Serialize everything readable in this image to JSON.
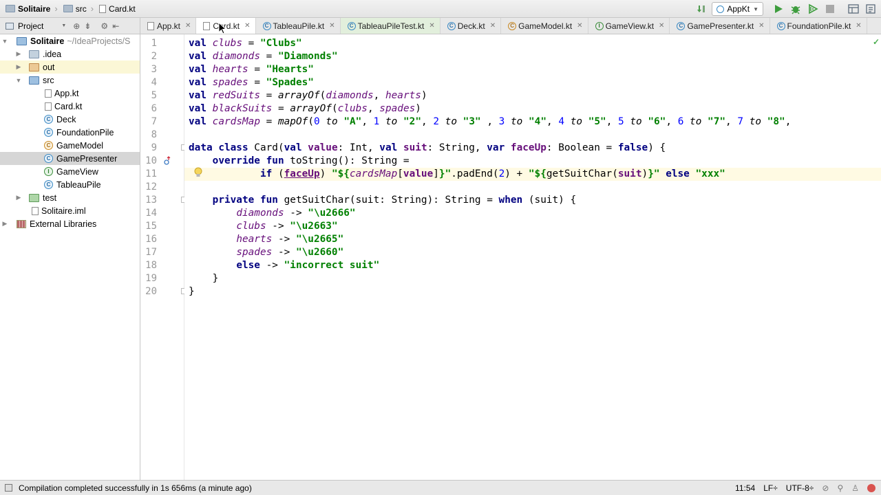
{
  "navbar": {
    "breadcrumbs": [
      "Solitaire",
      "src",
      "Card.kt"
    ]
  },
  "run": {
    "configuration": "AppKt"
  },
  "project_panel": {
    "title": "Project",
    "tree": [
      {
        "label": "Solitaire",
        "path": "~/IdeaProjects/S",
        "expanded": true
      },
      {
        "label": ".idea"
      },
      {
        "label": "out"
      },
      {
        "label": "src",
        "expanded": true
      },
      {
        "label": "App.kt"
      },
      {
        "label": "Card.kt"
      },
      {
        "label": "Deck"
      },
      {
        "label": "FoundationPile"
      },
      {
        "label": "GameModel"
      },
      {
        "label": "GamePresenter",
        "selected": true
      },
      {
        "label": "GameView"
      },
      {
        "label": "TableauPile"
      },
      {
        "label": "test"
      },
      {
        "label": "Solitaire.iml"
      },
      {
        "label": "External Libraries"
      }
    ]
  },
  "tabs": [
    {
      "label": "App.kt"
    },
    {
      "label": "Card.kt",
      "active": true
    },
    {
      "label": "TableauPile.kt"
    },
    {
      "label": "TableauPileTest.kt"
    },
    {
      "label": "Deck.kt"
    },
    {
      "label": "GameModel.kt"
    },
    {
      "label": "GameView.kt"
    },
    {
      "label": "GamePresenter.kt"
    },
    {
      "label": "FoundationPile.kt"
    }
  ],
  "editor": {
    "line_numbers": [
      "1",
      "2",
      "3",
      "4",
      "5",
      "6",
      "7",
      "8",
      "9",
      "10",
      "11",
      "12",
      "13",
      "14",
      "15",
      "16",
      "17",
      "18",
      "19",
      "20"
    ],
    "lines": [
      "val clubs = \"Clubs\"",
      "val diamonds = \"Diamonds\"",
      "val hearts = \"Hearts\"",
      "val spades = \"Spades\"",
      "val redSuits = arrayOf(diamonds, hearts)",
      "val blackSuits = arrayOf(clubs, spades)",
      "val cardsMap = mapOf(0 to \"A\", 1 to \"2\", 2 to \"3\" , 3 to \"4\", 4 to \"5\", 5 to \"6\", 6 to \"7\", 7 to \"8\",",
      "",
      "data class Card(val value: Int, val suit: String, var faceUp: Boolean = false) {",
      "    override fun toString(): String =",
      "            if (faceUp) \"${cardsMap[value]}\".padEnd(2) + \"${getSuitChar(suit)}\" else \"xxx\"",
      "",
      "    private fun getSuitChar(suit: String): String = when (suit) {",
      "        diamonds -> \"\\u2666\"",
      "        clubs -> \"\\u2663\"",
      "        hearts -> \"\\u2665\"",
      "        spades -> \"\\u2660\"",
      "        else -> \"incorrect suit\"",
      "    }",
      "}"
    ]
  },
  "status_bar": {
    "message": "Compilation completed successfully in 1s 656ms (a minute ago)",
    "position": "11:54",
    "line_separator": "LF÷",
    "encoding": "UTF-8÷"
  }
}
